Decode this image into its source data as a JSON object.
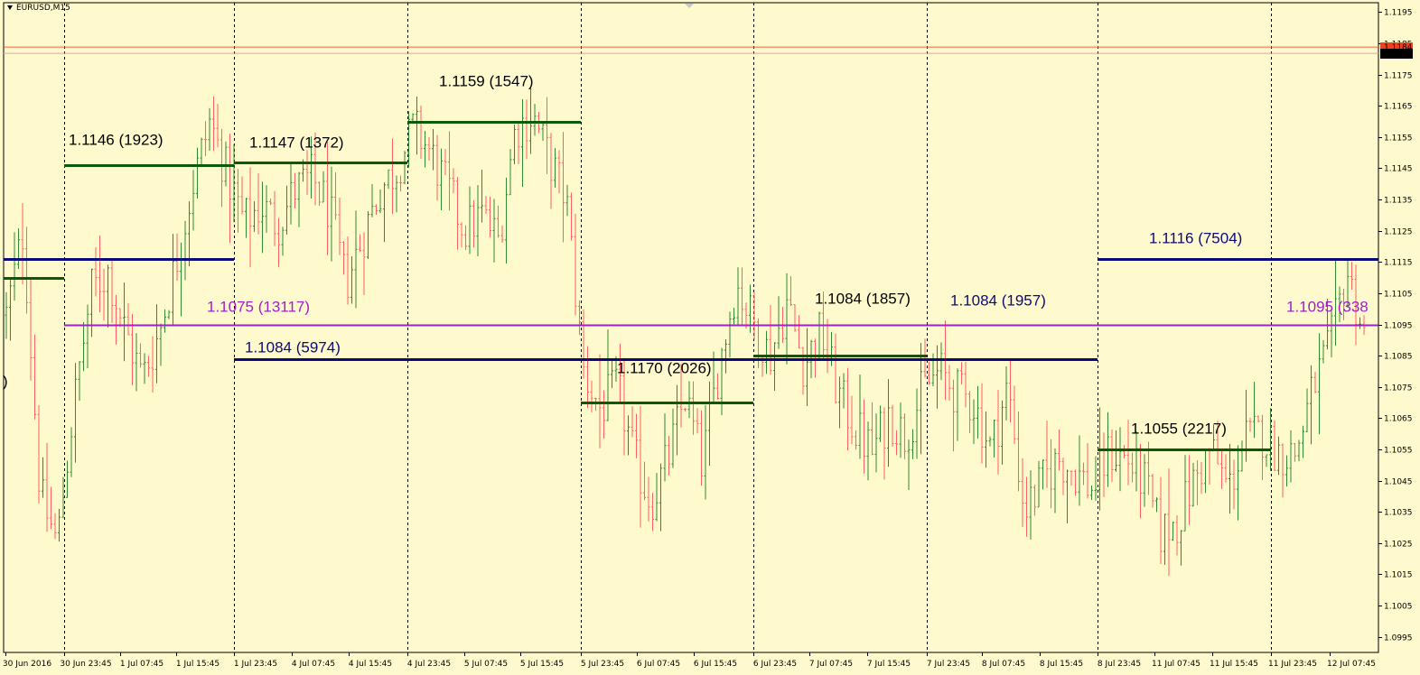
{
  "symbol": "EURUSD,M15",
  "colors": {
    "background": "#fffacd",
    "bull": "#2e8b2e",
    "bear": "#ff6060",
    "grid": "#000000",
    "axis": "#000000",
    "dark_green": "#0a5a0a",
    "navy": "#0a0a78",
    "purple": "#a020c8",
    "price_line": "#ff6040"
  },
  "chart_data": {
    "type": "candlestick",
    "ylim": [
      1.099,
      1.1198
    ],
    "y_ticks": [
      "1.1195",
      "1.1185",
      "1.1175",
      "1.1165",
      "1.1155",
      "1.1145",
      "1.1135",
      "1.1125",
      "1.1115",
      "1.1105",
      "1.1095",
      "1.1085",
      "1.1075",
      "1.1065",
      "1.1055",
      "1.1045",
      "1.1035",
      "1.1025",
      "1.1015",
      "1.1005",
      "1.0995"
    ],
    "current_price_labels": [
      "1.1184",
      "1.1182"
    ],
    "x_labels": [
      "30 Jun 2016",
      "30 Jun 23:45",
      "1 Jul 07:45",
      "1 Jul 15:45",
      "1 Jul 23:45",
      "4 Jul 07:45",
      "4 Jul 15:45",
      "4 Jul 23:45",
      "5 Jul 07:45",
      "5 Jul 15:45",
      "5 Jul 23:45",
      "6 Jul 07:45",
      "6 Jul 15:45",
      "6 Jul 23:45",
      "7 Jul 07:45",
      "7 Jul 15:45",
      "7 Jul 23:45",
      "8 Jul 07:45",
      "8 Jul 15:45",
      "8 Jul 23:45",
      "11 Jul 07:45",
      "11 Jul 15:45",
      "11 Jul 23:45",
      "12 Jul 07:45"
    ],
    "session_breaks": [
      "30 Jun 23:45",
      "1 Jul 23:45",
      "4 Jul 23:45",
      "5 Jul 23:45",
      "6 Jul 23:45",
      "7 Jul 23:45",
      "8 Jul 23:45",
      "11 Jul 23:45"
    ],
    "price_path": [
      [
        0,
        1.1098
      ],
      [
        2,
        1.1125
      ],
      [
        4,
        1.104
      ],
      [
        6,
        1.1025
      ],
      [
        8,
        1.107
      ],
      [
        10,
        1.1106
      ],
      [
        12,
        1.1112
      ],
      [
        14,
        1.1093
      ],
      [
        16,
        1.1078
      ],
      [
        18,
        1.1092
      ],
      [
        20,
        1.1115
      ],
      [
        22,
        1.114
      ],
      [
        24,
        1.116
      ],
      [
        26,
        1.1143
      ],
      [
        28,
        1.1128
      ],
      [
        30,
        1.1133
      ],
      [
        32,
        1.1127
      ],
      [
        34,
        1.1138
      ],
      [
        36,
        1.1142
      ],
      [
        38,
        1.1132
      ],
      [
        40,
        1.1108
      ],
      [
        42,
        1.1123
      ],
      [
        44,
        1.1138
      ],
      [
        46,
        1.1145
      ],
      [
        48,
        1.1158
      ],
      [
        50,
        1.115
      ],
      [
        52,
        1.1138
      ],
      [
        54,
        1.1125
      ],
      [
        56,
        1.113
      ],
      [
        58,
        1.1122
      ],
      [
        60,
        1.1158
      ],
      [
        62,
        1.1162
      ],
      [
        64,
        1.1148
      ],
      [
        66,
        1.1135
      ],
      [
        68,
        1.108
      ],
      [
        70,
        1.1068
      ],
      [
        72,
        1.1075
      ],
      [
        74,
        1.1052
      ],
      [
        76,
        1.1038
      ],
      [
        78,
        1.1052
      ],
      [
        80,
        1.1072
      ],
      [
        82,
        1.105
      ],
      [
        84,
        1.1082
      ],
      [
        86,
        1.1108
      ],
      [
        88,
        1.1096
      ],
      [
        90,
        1.1085
      ],
      [
        92,
        1.1102
      ],
      [
        94,
        1.1082
      ],
      [
        96,
        1.1093
      ],
      [
        98,
        1.1073
      ],
      [
        100,
        1.1062
      ],
      [
        102,
        1.1054
      ],
      [
        104,
        1.1066
      ],
      [
        106,
        1.1059
      ],
      [
        108,
        1.1074
      ],
      [
        110,
        1.108
      ],
      [
        112,
        1.1073
      ],
      [
        114,
        1.107
      ],
      [
        116,
        1.1055
      ],
      [
        118,
        1.1075
      ],
      [
        120,
        1.1035
      ],
      [
        122,
        1.1044
      ],
      [
        124,
        1.1052
      ],
      [
        126,
        1.1048
      ],
      [
        128,
        1.1042
      ],
      [
        130,
        1.1054
      ],
      [
        132,
        1.1052
      ],
      [
        134,
        1.1045
      ],
      [
        136,
        1.1028
      ],
      [
        138,
        1.1032
      ],
      [
        140,
        1.1045
      ],
      [
        142,
        1.1055
      ],
      [
        144,
        1.1042
      ],
      [
        146,
        1.1058
      ],
      [
        148,
        1.106
      ],
      [
        150,
        1.1054
      ],
      [
        152,
        1.1054
      ],
      [
        154,
        1.1075
      ],
      [
        156,
        1.1088
      ],
      [
        158,
        1.1112
      ],
      [
        160,
        1.1092
      ]
    ],
    "horizontal_levels": [
      {
        "label": "1.1146 (1923)",
        "price": 1.1146,
        "from": "30 Jun 23:45",
        "to": "1 Jul 23:45",
        "color": "dark_green"
      },
      {
        "label": "1.1147 (1372)",
        "price": 1.1147,
        "from": "1 Jul 23:45",
        "to": "4 Jul 23:45",
        "color": "dark_green"
      },
      {
        "label": "1.1159 (1547)",
        "price": 1.116,
        "from": "4 Jul 23:45",
        "to": "5 Jul 23:45",
        "color": "dark_green"
      },
      {
        "label": "1.1170 (2026)",
        "price": 1.107,
        "from": "5 Jul 23:45",
        "to": "6 Jul 23:45",
        "color": "dark_green"
      },
      {
        "label": "1.1084 (1857)",
        "price": 1.1085,
        "from": "6 Jul 23:45",
        "to": "7 Jul 23:45",
        "color": "dark_green"
      },
      {
        "label": "1.1084 (1957)",
        "price": 1.1084,
        "from": "7 Jul 23:45",
        "to": "8 Jul 23:45",
        "color": "navy"
      },
      {
        "label": "1.1055 (2217)",
        "price": 1.1055,
        "from": "8 Jul 23:45",
        "to": "11 Jul 23:45",
        "color": "dark_green"
      },
      {
        "label": "1.1116 (7504)",
        "price": 1.1116,
        "from": "8 Jul 23:45",
        "to": "end",
        "color": "navy"
      },
      {
        "label": "1.1095 (338",
        "price": 1.1095,
        "from": "11 Jul 23:45",
        "to": "end",
        "color": "purple"
      },
      {
        "label": "1.1084 (5974)",
        "price": 1.1084,
        "from": "1 Jul 23:45",
        "to": "8 Jul 23:45",
        "color": "navy"
      },
      {
        "label": "1.1075 (13117)",
        "price": 1.1095,
        "from": "30 Jun 23:45",
        "to": "end",
        "color": "purple"
      },
      {
        "label": "",
        "price": 1.1116,
        "from": "start",
        "to": "1 Jul 23:45",
        "color": "navy"
      },
      {
        "label": "",
        "price": 1.111,
        "from": "start",
        "to": "30 Jun 23:45",
        "color": "dark_green"
      }
    ],
    "left_edge_fragment": ")"
  }
}
